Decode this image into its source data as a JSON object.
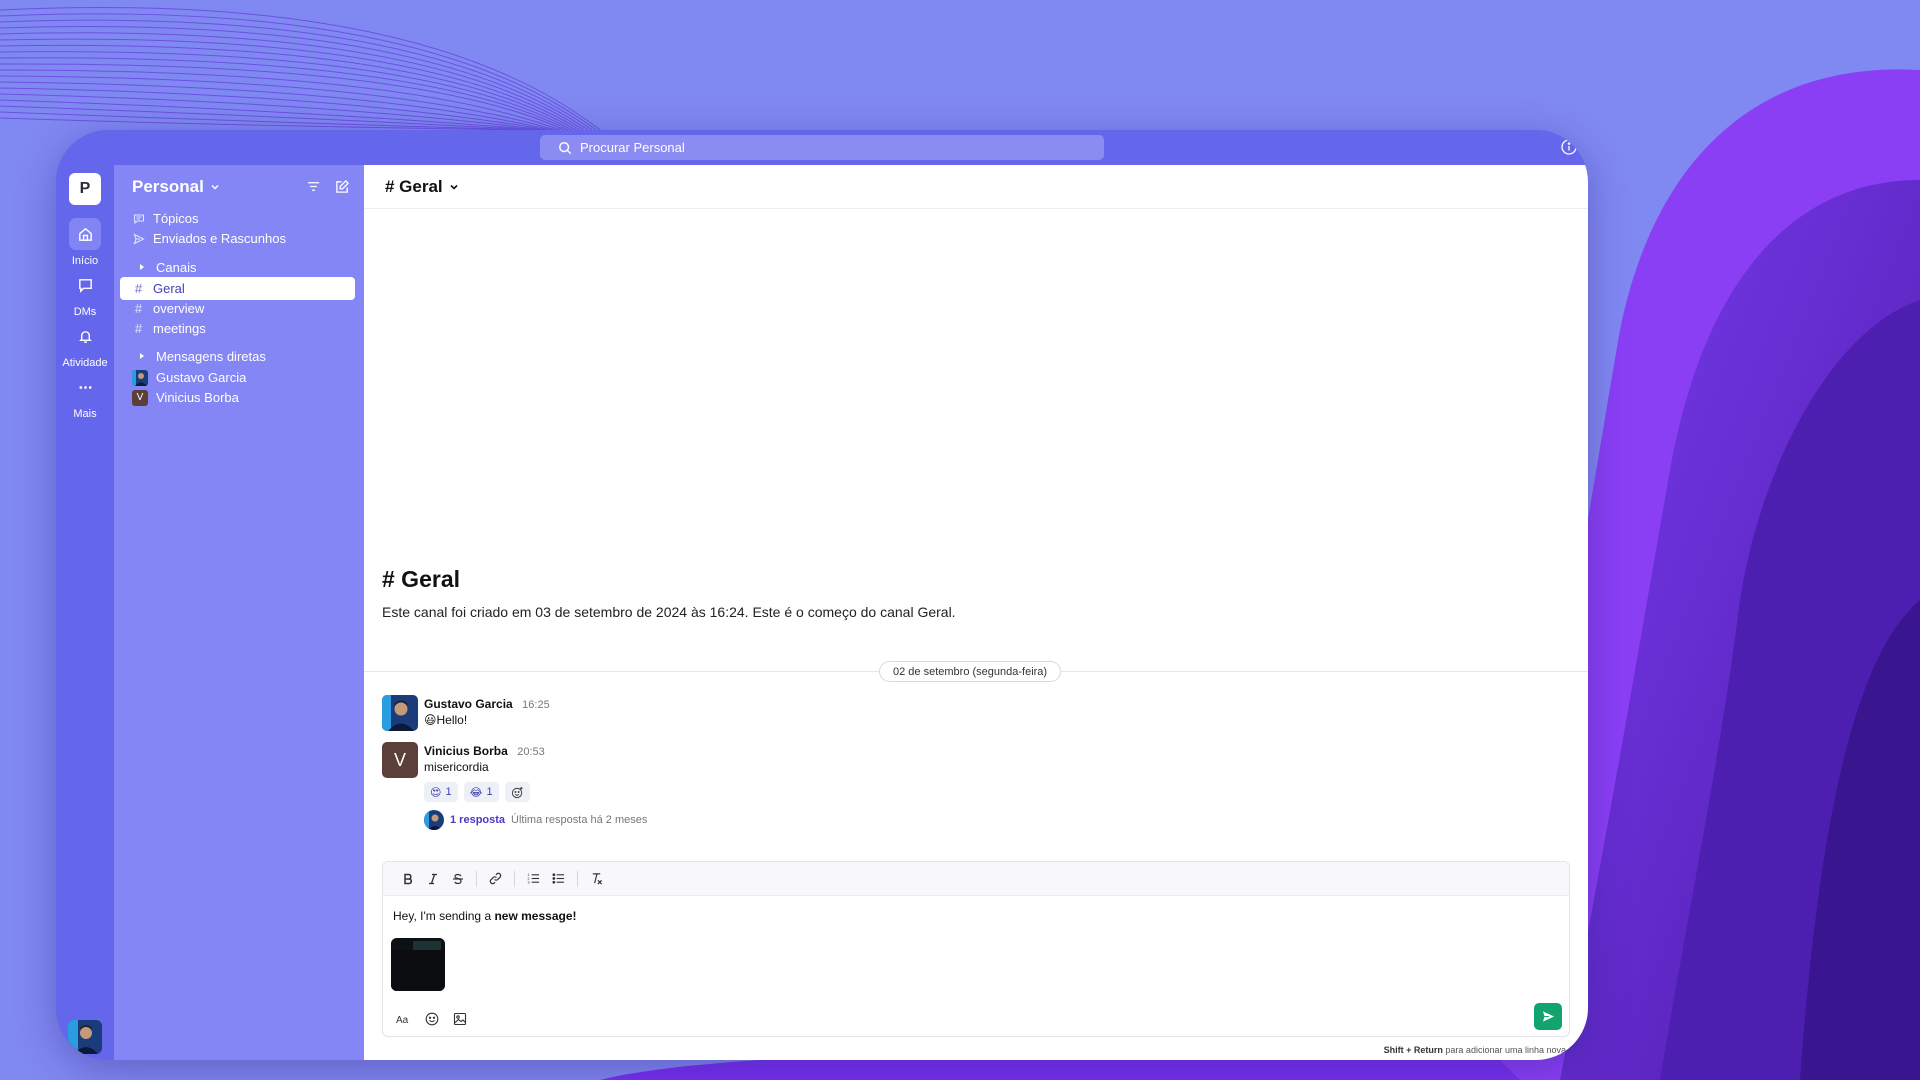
{
  "colors": {
    "background": "#8088f2",
    "rail": "#6466ec",
    "sidebar": "#8386f4",
    "accent": "#4b38c9",
    "send": "#12a46f"
  },
  "search": {
    "placeholder": "Procurar Personal",
    "icon": "search-icon"
  },
  "rail": {
    "workspace_initial": "P",
    "items": [
      {
        "label": "Início",
        "icon": "home-icon"
      },
      {
        "label": "DMs",
        "icon": "chat-bubble-icon"
      },
      {
        "label": "Atividade",
        "icon": "bell-icon"
      },
      {
        "label": "Mais",
        "icon": "more-icon"
      }
    ]
  },
  "sidebar": {
    "workspace_name": "Personal",
    "top_items": [
      {
        "label": "Tópicos",
        "icon": "threads-icon"
      },
      {
        "label": "Enviados e Rascunhos",
        "icon": "send-icon"
      }
    ],
    "channels_section": "Canais",
    "channels": [
      {
        "label": "Geral",
        "active": true
      },
      {
        "label": "overview",
        "active": false
      },
      {
        "label": "meetings",
        "active": false
      }
    ],
    "dm_section": "Mensagens diretas",
    "dms": [
      {
        "label": "Gustavo Garcia",
        "initial": ""
      },
      {
        "label": "Vinicius Borba",
        "initial": "V"
      }
    ]
  },
  "channel": {
    "header": "# Geral",
    "intro_title": "# Geral",
    "intro_text": "Este canal foi criado em 03 de setembro de 2024 às 16:24. Este é o começo do canal Geral.",
    "date_divider": "02 de setembro (segunda-feira)"
  },
  "messages": [
    {
      "author": "Gustavo Garcia",
      "time": "16:25",
      "text": "😃Hello!"
    },
    {
      "author": "Vinicius Borba",
      "time": "20:53",
      "text": "misericordia",
      "avatar_initial": "V",
      "reactions": [
        {
          "emoji": "😍",
          "count": "1"
        },
        {
          "emoji": "😂",
          "count": "1"
        }
      ],
      "thread": {
        "count": "1 resposta",
        "last": "Última resposta há 2 meses"
      }
    }
  ],
  "composer": {
    "draft_prefix": "Hey, I'm sending a ",
    "draft_bold": "new message!",
    "hint_keys": "Shift + Return",
    "hint_text": " para adicionar uma linha nova"
  }
}
